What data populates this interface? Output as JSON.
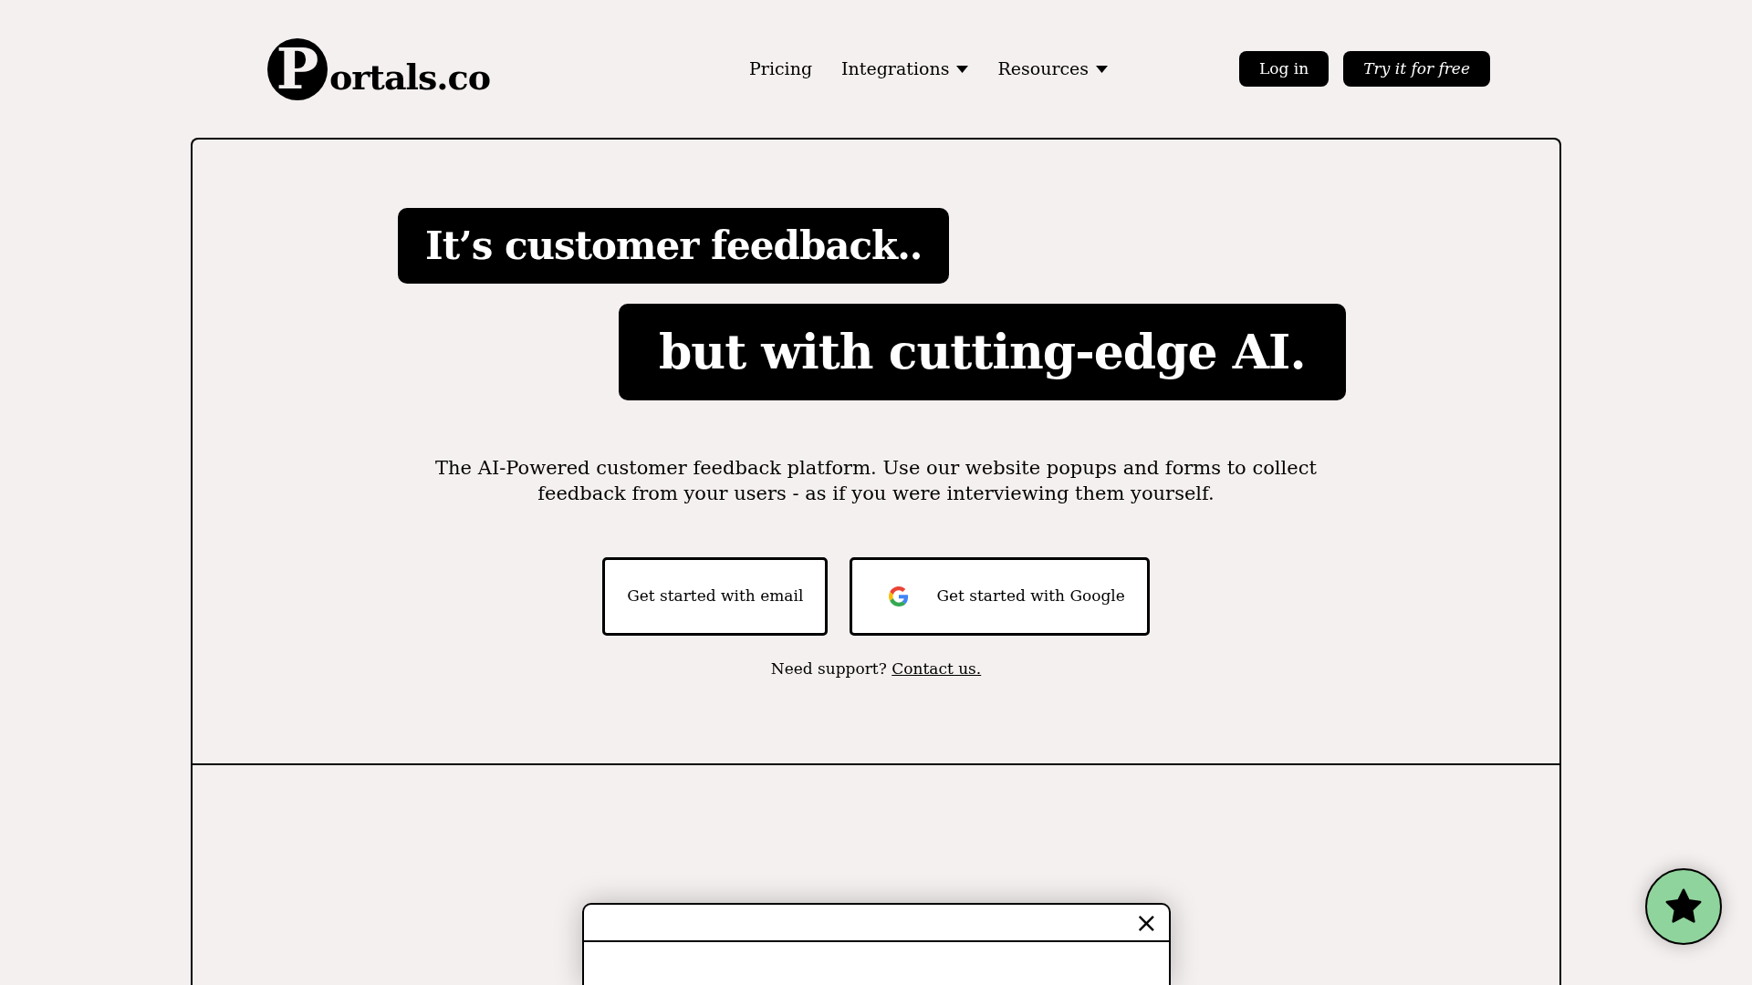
{
  "header": {
    "logo_mark": "P",
    "logo_text": "ortals.co",
    "nav": [
      {
        "label": "Pricing",
        "dropdown": false
      },
      {
        "label": "Integrations",
        "dropdown": true
      },
      {
        "label": "Resources",
        "dropdown": true
      }
    ],
    "buttons": [
      {
        "label": "Log in",
        "italic": false
      },
      {
        "label": "Try it for free",
        "italic": true
      }
    ]
  },
  "hero": {
    "headline_1": "It’s customer feedback..",
    "headline_2": "but with cutting-edge AI.",
    "description": "The AI-Powered customer feedback platform. Use our website popups and forms to collect feedback from your users - as if you were interviewing them yourself.",
    "cta": [
      {
        "label": "Get started with email",
        "kind": "email"
      },
      {
        "label": "Get started with Google",
        "kind": "google"
      }
    ],
    "support": {
      "text": "Need support?",
      "link": "Contact us."
    }
  },
  "popup": {
    "close": "×"
  }
}
